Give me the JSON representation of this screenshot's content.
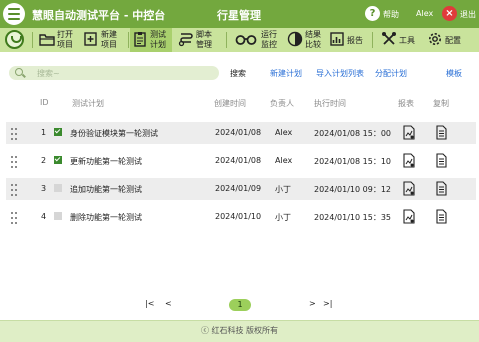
{
  "header": {
    "app_title": "慧眼自动测试平台 - 中控台",
    "page_title": "行星管理",
    "help_label": "帮助",
    "user_name": "Alex",
    "logout_label": "退出",
    "help_icon_glyph": "?",
    "logout_icon_glyph": "×"
  },
  "toolbar": {
    "items": [
      {
        "label1": "打开",
        "label2": "项目",
        "icon": "folder-open-icon"
      },
      {
        "label1": "新建",
        "label2": "项目",
        "icon": "new-document-icon"
      },
      {
        "label1": "测试",
        "label2": "计划",
        "icon": "clipboard-icon",
        "active": true
      },
      {
        "label1": "脚本",
        "label2": "管理",
        "icon": "script-icon"
      },
      {
        "label1": "运行",
        "label2": "监控",
        "icon": "binoculars-icon"
      },
      {
        "label1": "结果",
        "label2": "比较",
        "icon": "contrast-icon"
      },
      {
        "label": "报告",
        "icon": "report-icon"
      },
      {
        "label": "工具",
        "icon": "tools-icon"
      },
      {
        "label": "配置",
        "icon": "gear-icon"
      }
    ]
  },
  "search": {
    "placeholder": "搜索~",
    "value": ""
  },
  "actions": {
    "search": "搜索",
    "new_plan": "新建计划",
    "import_plan_list": "导入计划列表",
    "assign_plan": "分配计划",
    "template": "模板"
  },
  "table": {
    "columns": {
      "id": "ID",
      "plan": "测试计划",
      "created": "创建时间",
      "owner": "负责人",
      "executed": "执行时间",
      "report": "报表",
      "copy": "复制"
    },
    "rows": [
      {
        "id": "1",
        "checked": true,
        "plan": "身份验证模块第一轮测试",
        "created": "2024/01/08",
        "owner": "Alex",
        "executed": "2024/01/08 15：00"
      },
      {
        "id": "2",
        "checked": true,
        "plan": "更新功能第一轮测试",
        "created": "2024/01/08",
        "owner": "Alex",
        "executed": "2024/01/08 15：10"
      },
      {
        "id": "3",
        "checked": false,
        "plan": "追加功能第一轮测试",
        "created": "2024/01/09",
        "owner": "小丁",
        "executed": "2024/01/10 09：12"
      },
      {
        "id": "4",
        "checked": false,
        "plan": "删除功能第一轮测试",
        "created": "2024/01/10",
        "owner": "小丁",
        "executed": "2024/01/10 15：35"
      }
    ]
  },
  "pager": {
    "first": "|<",
    "prev": "<",
    "current": "1",
    "next": ">",
    "last": ">|"
  },
  "footer": {
    "copyright": "ⓒ  红石科技 版权所有"
  },
  "colors": {
    "titlebar": "#73a83e",
    "toolbar": "#c9e39c",
    "accent_link": "#2a6fd6",
    "check_green": "#3b8a2e",
    "logout_red": "#e03b3b"
  }
}
